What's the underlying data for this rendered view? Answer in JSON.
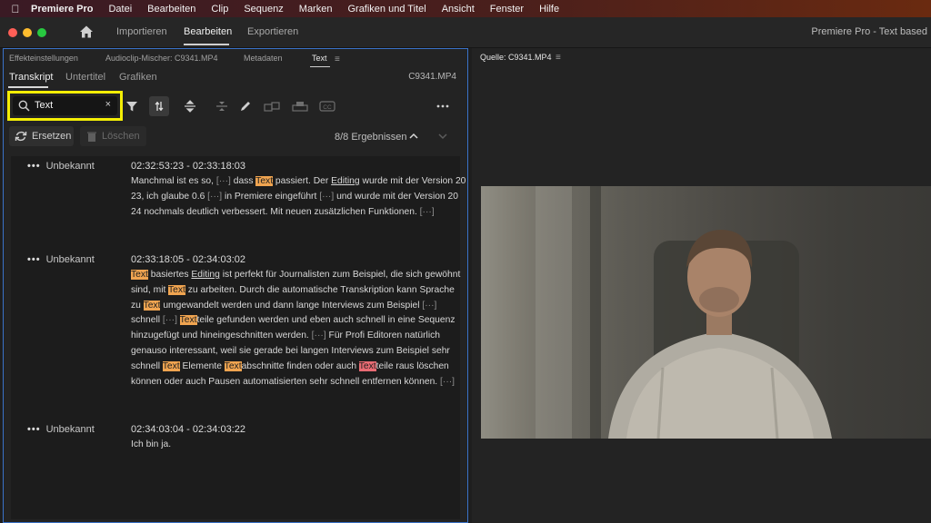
{
  "menubar": {
    "items": [
      "Premiere Pro",
      "Datei",
      "Bearbeiten",
      "Clip",
      "Sequenz",
      "Marken",
      "Grafiken und Titel",
      "Ansicht",
      "Fenster",
      "Hilfe"
    ]
  },
  "titlebar": {
    "tabs": [
      "Importieren",
      "Bearbeiten",
      "Exportieren"
    ],
    "active_tab": "Bearbeiten",
    "app_title": "Premiere Pro - Text based"
  },
  "left_panel": {
    "tabs": [
      "Effekteinstellungen",
      "Audioclip-Mischer: C9341.MP4",
      "Metadaten",
      "Text"
    ],
    "active_tab": "Text",
    "subtabs": [
      "Transkript",
      "Untertitel",
      "Grafiken"
    ],
    "active_subtab": "Transkript",
    "clip_name": "C9341.MP4",
    "search": {
      "value": "Text",
      "clear": "×"
    },
    "replace_label": "Ersetzen",
    "delete_label": "Löschen",
    "results": "8/8 Ergebnissen"
  },
  "transcript": [
    {
      "speaker": "Unbekannt",
      "dots": "•••",
      "timecode": "02:32:53:23 - 02:33:18:03",
      "lines": [
        [
          {
            "t": "Manchmal ist es so, "
          },
          {
            "t": "[···]",
            "c": "gap"
          },
          {
            "t": " dass "
          },
          {
            "t": "Text",
            "c": "hl"
          },
          {
            "t": " passiert. Der "
          },
          {
            "t": "Editing",
            "c": "u"
          },
          {
            "t": " wurde mit der Version 20"
          }
        ],
        [
          {
            "t": "23, ich glaube 0.6 "
          },
          {
            "t": "[···]",
            "c": "gap"
          },
          {
            "t": " in Premiere eingeführt "
          },
          {
            "t": "[···]",
            "c": "gap"
          },
          {
            "t": " und wurde mit der Version 20"
          }
        ],
        [
          {
            "t": "24 nochmals deutlich verbessert. Mit neuen zusätzlichen Funktionen. "
          },
          {
            "t": "[···]",
            "c": "gap"
          }
        ]
      ]
    },
    {
      "speaker": "Unbekannt",
      "dots": "•••",
      "timecode": "02:33:18:05 - 02:34:03:02",
      "lines": [
        [
          {
            "t": "Text",
            "c": "hl"
          },
          {
            "t": " basiertes "
          },
          {
            "t": "Editing",
            "c": "u"
          },
          {
            "t": " ist perfekt für Journalisten zum Beispiel, die sich gewöhnt"
          }
        ],
        [
          {
            "t": "sind, mit "
          },
          {
            "t": "Text",
            "c": "hl"
          },
          {
            "t": " zu arbeiten. Durch die automatische Transkription kann Sprache"
          }
        ],
        [
          {
            "t": "zu "
          },
          {
            "t": "Text",
            "c": "hl"
          },
          {
            "t": " umgewandelt werden und dann lange Interviews zum Beispiel "
          },
          {
            "t": "[···]",
            "c": "gap"
          }
        ],
        [
          {
            "t": "schnell "
          },
          {
            "t": "[···]",
            "c": "gap"
          },
          {
            "t": " "
          },
          {
            "t": "Text",
            "c": "hl"
          },
          {
            "t": "teile gefunden werden und eben auch schnell in eine Sequenz"
          }
        ],
        [
          {
            "t": "hinzugefügt und hineingeschnitten werden. "
          },
          {
            "t": "[···]",
            "c": "gap"
          },
          {
            "t": " Für Profi Editoren natürlich"
          }
        ],
        [
          {
            "t": "genauso interessant, weil sie gerade bei langen Interviews zum Beispiel sehr"
          }
        ],
        [
          {
            "t": "schnell "
          },
          {
            "t": "Text",
            "c": "hl"
          },
          {
            "t": " Elemente "
          },
          {
            "t": "Text",
            "c": "hl"
          },
          {
            "t": "abschnitte finden oder auch "
          },
          {
            "t": "Text",
            "c": "hl-red"
          },
          {
            "t": "teile raus löschen"
          }
        ],
        [
          {
            "t": "können oder auch Pausen automatisierten sehr schnell entfernen können. "
          },
          {
            "t": "[···]",
            "c": "gap"
          }
        ]
      ]
    },
    {
      "speaker": "Unbekannt",
      "dots": "•••",
      "timecode": "02:34:03:04 - 02:34:03:22",
      "lines": [
        [
          {
            "t": "Ich bin ja."
          }
        ]
      ]
    }
  ],
  "right_panel": {
    "tab": "Quelle: C9341.MP4",
    "menu": "≡"
  },
  "colors": {
    "search_highlight": "#f4ee05",
    "match_highlight": "#f0a450",
    "current_match": "#e96b73",
    "panel_focus": "#3a72c8"
  }
}
